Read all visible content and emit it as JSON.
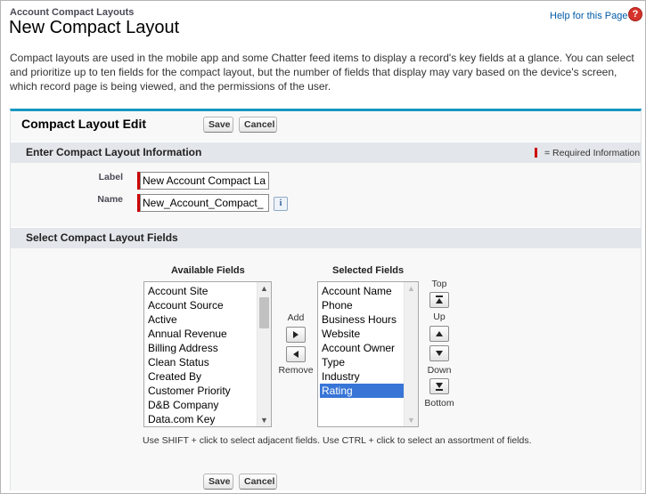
{
  "header": {
    "breadcrumb": "Account Compact Layouts",
    "title": "New Compact Layout",
    "help_link": "Help for this Page",
    "help_icon": "?"
  },
  "description": "Compact layouts are used in the mobile app and some Chatter feed items to display a record's key fields at a glance. You can select and prioritize up to ten fields for the compact layout, but the number of fields that display may vary based on the device's screen, which record page is being viewed, and the permissions of the user.",
  "edit_panel": {
    "title": "Compact Layout Edit",
    "save_label": "Save",
    "cancel_label": "Cancel"
  },
  "info_section": {
    "title": "Enter Compact Layout Information",
    "required_legend": "= Required Information",
    "label_field": {
      "label": "Label",
      "value": "New Account Compact La"
    },
    "name_field": {
      "label": "Name",
      "value": "New_Account_Compact_"
    },
    "info_icon": "i"
  },
  "fields_section": {
    "title": "Select Compact Layout Fields",
    "available_title": "Available Fields",
    "selected_title": "Selected Fields",
    "available_fields": [
      "Account Site",
      "Account Source",
      "Active",
      "Annual Revenue",
      "Billing Address",
      "Clean Status",
      "Created By",
      "Customer Priority",
      "D&B Company",
      "Data.com Key"
    ],
    "selected_fields": [
      "Account Name",
      "Phone",
      "Business Hours",
      "Website",
      "Account Owner",
      "Type",
      "Industry",
      "Rating"
    ],
    "selected_highlight": "Rating",
    "add_label": "Add",
    "remove_label": "Remove",
    "top_label": "Top",
    "up_label": "Up",
    "down_label": "Down",
    "bottom_label": "Bottom",
    "hint": "Use SHIFT + click to select adjacent fields. Use CTRL + click to select an assortment of fields."
  },
  "colors": {
    "accent": "#1797c0",
    "required": "#cc0000",
    "selection": "#3875d7",
    "link": "#015ba7"
  }
}
